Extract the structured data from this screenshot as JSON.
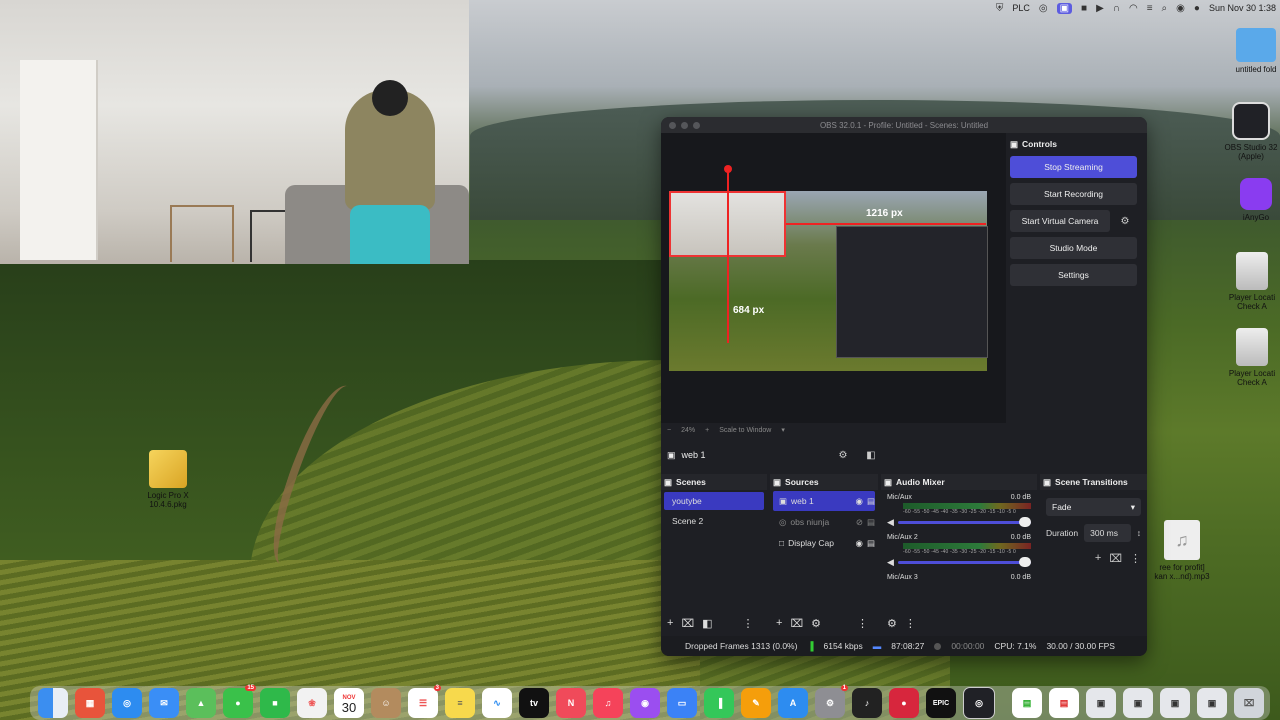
{
  "menubar": {
    "vpn_label": "PLC",
    "datetime": "Sun Nov 30  1:38"
  },
  "desktop": {
    "left_icon": "Logic Pro X\n10.4.6.pkg",
    "right_icons": [
      {
        "label": "untitled fold"
      },
      {
        "label": "OBS Studio 32\n(Apple)"
      },
      {
        "label": "iAnyGo"
      },
      {
        "label": "Player Locati\nCheck A"
      },
      {
        "label": "Player Locati\nCheck A"
      },
      {
        "label": "ree for profit]\nkan x...nd).mp3"
      }
    ]
  },
  "obs": {
    "title": "OBS 32.0.1 - Profile: Untitled - Scenes: Untitled",
    "preview": {
      "width_label": "1216 px",
      "height_label": "684 px",
      "zoom": "24%",
      "scale_mode": "Scale to Window"
    },
    "source_bar": {
      "current_source": "web 1"
    },
    "controls": {
      "title": "Controls",
      "stop_streaming": "Stop Streaming",
      "start_recording": "Start Recording",
      "start_virtual_camera": "Start Virtual Camera",
      "studio_mode": "Studio Mode",
      "settings": "Settings"
    },
    "scenes": {
      "title": "Scenes",
      "items": [
        "youtybe",
        "Scene 2"
      ]
    },
    "sources": {
      "title": "Sources",
      "items": [
        "web 1",
        "obs niunja",
        "Display Cap"
      ]
    },
    "audio_mixer": {
      "title": "Audio Mixer",
      "ticks": "-60 -55 -50 -45 -40 -35 -30 -25 -20 -15 -10 -5 0",
      "channels": [
        {
          "name": "Mic/Aux",
          "level": "0.0 dB"
        },
        {
          "name": "Mic/Aux 2",
          "level": "0.0 dB"
        },
        {
          "name": "Mic/Aux 3",
          "level": "0.0 dB"
        }
      ]
    },
    "transitions": {
      "title": "Scene Transitions",
      "selected": "Fade",
      "duration_label": "Duration",
      "duration_value": "300 ms"
    },
    "status": {
      "dropped_frames": "Dropped Frames 1313 (0.0%)",
      "bitrate": "6154 kbps",
      "stream_time": "87:08:27",
      "record_time": "00:00:00",
      "cpu": "CPU: 7.1%",
      "fps": "30.00 / 30.00 FPS"
    }
  },
  "dock": {
    "calendar_month": "NOV",
    "calendar_day": "30",
    "messages_badge": "15",
    "reminders_badge": "3",
    "settings_badge": "1"
  }
}
